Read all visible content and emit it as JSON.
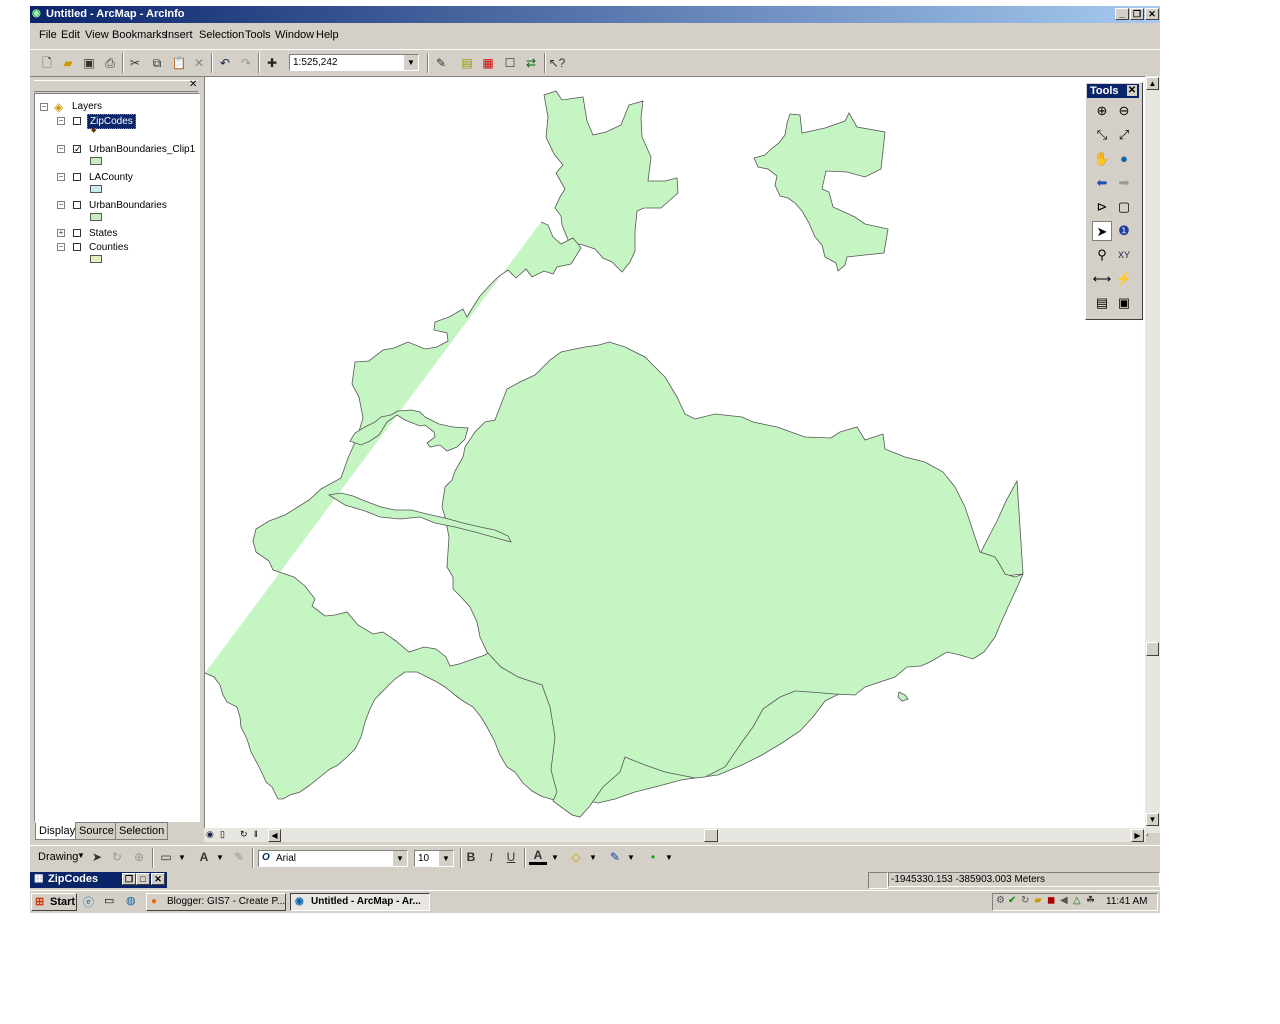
{
  "window": {
    "title": "Untitled - ArcMap - ArcInfo"
  },
  "menu": [
    "File",
    "Edit",
    "View",
    "Bookmarks",
    "Insert",
    "Selection",
    "Tools",
    "Window",
    "Help"
  ],
  "toolbar": {
    "scale": "1:525,242"
  },
  "toc": {
    "root": "Layers",
    "layers": [
      {
        "name": "ZipCodes",
        "checked": false,
        "selected": true
      },
      {
        "name": "UrbanBoundaries_Clip1",
        "checked": true,
        "color": "#c8ecc0"
      },
      {
        "name": "LACounty",
        "checked": false,
        "color": "#c8ecf0"
      },
      {
        "name": "UrbanBoundaries",
        "checked": false,
        "color": "#c8ecc0"
      },
      {
        "name": "States",
        "checked": false
      },
      {
        "name": "Counties",
        "checked": false,
        "color": "#e0f0c0"
      }
    ],
    "tabs": [
      "Display",
      "Source",
      "Selection"
    ]
  },
  "tools_panel": {
    "title": "Tools"
  },
  "drawing": {
    "label": "Drawing",
    "font": "Arial",
    "size": "10"
  },
  "status": {
    "layer": "ZipCodes",
    "coords": "-1945330.153  -385903.003 Meters"
  },
  "taskbar": {
    "start": "Start",
    "tasks": [
      "Blogger: GIS7 - Create P...",
      "Untitled - ArcMap - Ar..."
    ],
    "clock": "11:41 AM"
  },
  "colors": {
    "polygon_fill": "#c6f5c4",
    "polygon_stroke": "#555555",
    "title_bar": "#0a246a"
  }
}
